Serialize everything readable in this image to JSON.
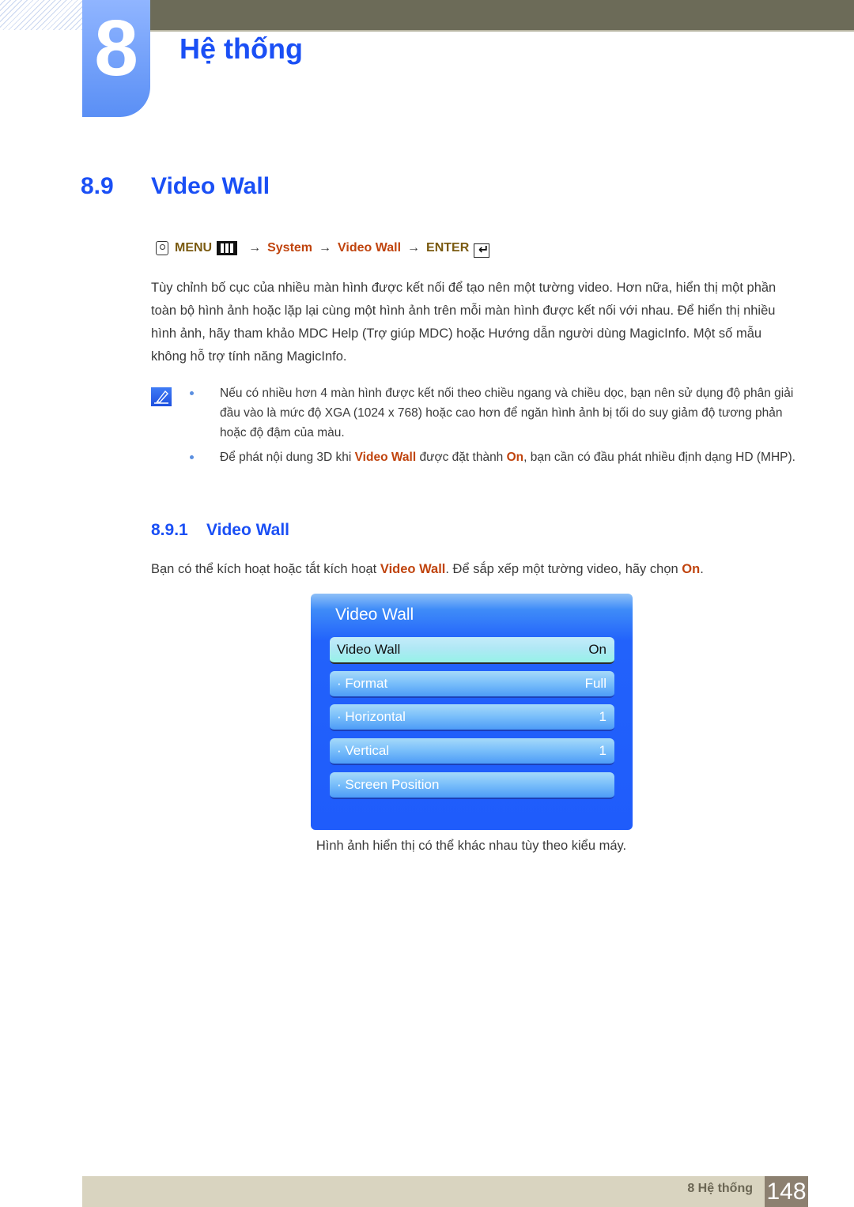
{
  "chapter": {
    "number": "8",
    "title": "Hệ thống"
  },
  "section": {
    "number": "8.9",
    "title": "Video Wall"
  },
  "menu_path": {
    "icon": "remote-hand-icon",
    "menu_label": "MENU",
    "menu_icon": "menu-bars-icon",
    "arrow": "→",
    "step1": "System",
    "step2": "Video Wall",
    "enter_label": "ENTER",
    "enter_icon": "enter-return-icon"
  },
  "intro_paragraph": "Tùy chỉnh bố cục của nhiều màn hình được kết nối để tạo nên một tường video. Hơn nữa, hiển thị một phần toàn bộ hình ảnh hoặc lặp lại cùng một hình ảnh trên mỗi màn hình được kết nối với nhau. Để hiển thị nhiều hình ảnh, hãy tham khảo MDC Help (Trợ giúp MDC) hoặc Hướng dẫn người dùng MagicInfo. Một số mẫu không hỗ trợ tính năng MagicInfo.",
  "notes": {
    "icon": "note-pencil-icon",
    "items": [
      {
        "text": "Nếu có nhiều hơn 4 màn hình được kết nối theo chiều ngang và chiều dọc, bạn nên sử dụng độ phân giải đầu vào là mức độ XGA (1024 x 768) hoặc cao hơn để ngăn hình ảnh bị tối do suy giảm độ tương phản hoặc độ đậm của màu."
      },
      {
        "prefix": "Để phát nội dung 3D khi ",
        "hl1": "Video Wall",
        "mid": " được đặt thành ",
        "hl2": "On",
        "suffix": ", bạn cần có đầu phát nhiều định dạng HD (MHP)."
      }
    ]
  },
  "subsection": {
    "number": "8.9.1",
    "title": "Video Wall",
    "para_prefix": "Bạn có thể kích hoạt hoặc tắt kích hoạt ",
    "para_hl1": "Video Wall",
    "para_mid": ". Để sắp xếp một tường video, hãy chọn ",
    "para_hl2": "On",
    "para_suffix": "."
  },
  "osd": {
    "title": "Video Wall",
    "rows": [
      {
        "label": "Video Wall",
        "value": "On",
        "selected": true
      },
      {
        "label": "· Format",
        "value": "Full"
      },
      {
        "label": "· Horizontal",
        "value": "1"
      },
      {
        "label": "· Vertical",
        "value": "1"
      },
      {
        "label": "· Screen Position",
        "value": ""
      }
    ]
  },
  "caption": "Hình ảnh hiển thị có thể khác nhau tùy theo kiểu máy.",
  "footer": {
    "label": "8 Hệ thống",
    "page": "148"
  },
  "colors": {
    "heading_blue": "#1a4ff5",
    "highlight_rust": "#c0440e",
    "menu_gold": "#7a5a10",
    "header_band": "#6c6b58",
    "footer_band": "#d9d4c0",
    "osd_blue": "#1f5cfb"
  }
}
